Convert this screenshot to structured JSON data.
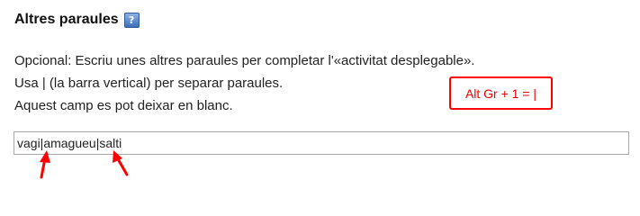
{
  "section": {
    "title": "Altres paraules",
    "help_icon_label": "?"
  },
  "help": {
    "line1": "Opcional: Escriu unes altres paraules per completar l'«activitat desplegable».",
    "line2": "Usa | (la barra vertical) per separar paraules.",
    "line3": "Aquest camp es pot deixar en blanc."
  },
  "annotation": {
    "text": "Alt Gr + 1 = |",
    "color": "#ff0000"
  },
  "input": {
    "value": "vagi|amagueu|salti"
  }
}
